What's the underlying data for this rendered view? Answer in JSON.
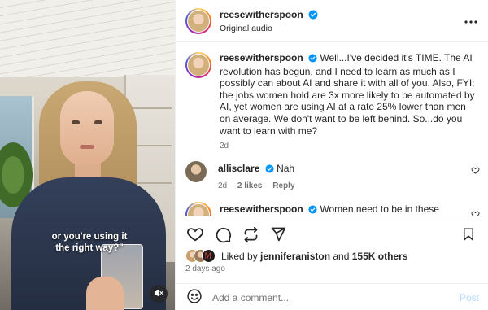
{
  "video": {
    "caption_line1": "or you're using it",
    "caption_line2": "the right way?\"",
    "mute_icon": "speaker-muted-icon"
  },
  "header": {
    "username": "reesewitherspoon",
    "subtitle": "Original audio",
    "more_icon": "more-horizontal-icon"
  },
  "comments": [
    {
      "username": "reesewitherspoon",
      "verified": true,
      "text": "Well...I've decided it's TIME. The AI revolution has begun, and I need to learn as much as I possibly can about AI and share it with all of you. Also, FYI: the jobs women hold are 3x more likely to be automated by AI, yet women are using AI at a rate 25% lower than men on average. We don't want to be left behind. So...do you want to learn with me?",
      "time": "2d"
    },
    {
      "username": "allisclare",
      "verified": true,
      "text": "Nah",
      "time": "2d",
      "likes": "2 likes",
      "reply": "Reply"
    },
    {
      "username": "reesewitherspoon",
      "verified": true,
      "text": "Women need to be in these"
    }
  ],
  "actions": {
    "like_icon": "heart-icon",
    "comment_icon": "comment-icon",
    "share_icon": "repost-icon",
    "send_icon": "send-icon",
    "save_icon": "bookmark-icon"
  },
  "likes": {
    "prefix": "Liked by ",
    "user": "jenniferaniston",
    "middle": " and ",
    "others": "155K others"
  },
  "date": "2 days ago",
  "add_comment": {
    "placeholder": "Add a comment...",
    "post_label": "Post"
  },
  "colors": {
    "text": "#262626",
    "secondary": "#737373",
    "verified": "#0095f6",
    "post_disabled": "#b3dbff",
    "divider": "#efefef"
  }
}
